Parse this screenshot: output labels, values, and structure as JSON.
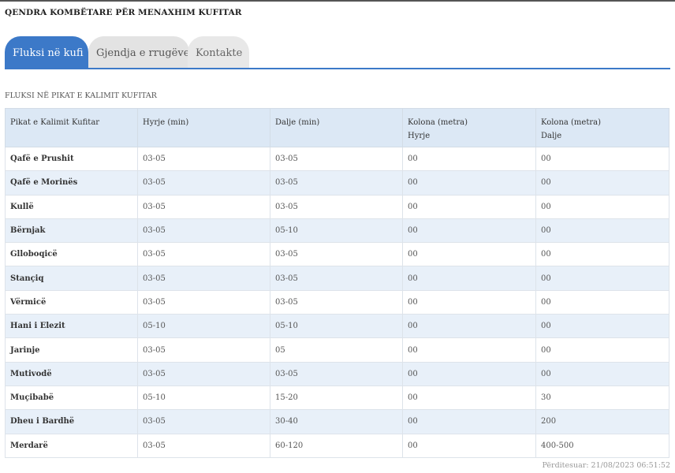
{
  "header": {
    "org_title": "QENDRA KOMBËTARE PËR MENAXHIM KUFITAR"
  },
  "tabs": [
    {
      "label": "Fluksi në kufi",
      "active": true
    },
    {
      "label": "Gjendja e rrugëve",
      "active": false
    },
    {
      "label": "Kontakte",
      "active": false
    }
  ],
  "section_caption": "FLUKSI NË PIKAT E KALIMIT KUFITAR",
  "table": {
    "headers": [
      {
        "line1": "Pikat e Kalimit Kufitar",
        "line2": ""
      },
      {
        "line1": "Hyrje (min)",
        "line2": ""
      },
      {
        "line1": "Dalje (min)",
        "line2": ""
      },
      {
        "line1": "Kolona (metra)",
        "line2": "Hyrje"
      },
      {
        "line1": "Kolona (metra)",
        "line2": "Dalje"
      }
    ],
    "rows": [
      [
        "Qafë e Prushit",
        "03-05",
        "03-05",
        "00",
        "00"
      ],
      [
        "Qafë e Morinës",
        "03-05",
        "03-05",
        "00",
        "00"
      ],
      [
        "Kullë",
        "03-05",
        "03-05",
        "00",
        "00"
      ],
      [
        "Bërnjak",
        "03-05",
        "05-10",
        "00",
        "00"
      ],
      [
        "Glloboqicë",
        "03-05",
        "03-05",
        "00",
        "00"
      ],
      [
        "Stançiq",
        "03-05",
        "03-05",
        "00",
        "00"
      ],
      [
        "Vërmicë",
        "03-05",
        "03-05",
        "00",
        "00"
      ],
      [
        "Hani i Elezit",
        "05-10",
        "05-10",
        "00",
        "00"
      ],
      [
        "Jarinje",
        "03-05",
        "05",
        "00",
        "00"
      ],
      [
        "Mutivodë",
        "03-05",
        "03-05",
        "00",
        "00"
      ],
      [
        "Muçibabë",
        "05-10",
        "15-20",
        "00",
        "30"
      ],
      [
        "Dheu i Bardhë",
        "03-05",
        "30-40",
        "00",
        "200"
      ],
      [
        "Merdarë",
        "03-05",
        "60-120",
        "00",
        "400-500"
      ]
    ]
  },
  "footer": {
    "updated": "Përditesuar: 21/08/2023 06:51:52"
  },
  "colors": {
    "accent": "#3c79c8",
    "header_bg": "#dce8f5",
    "row_alt_bg": "#e8f0f9"
  }
}
